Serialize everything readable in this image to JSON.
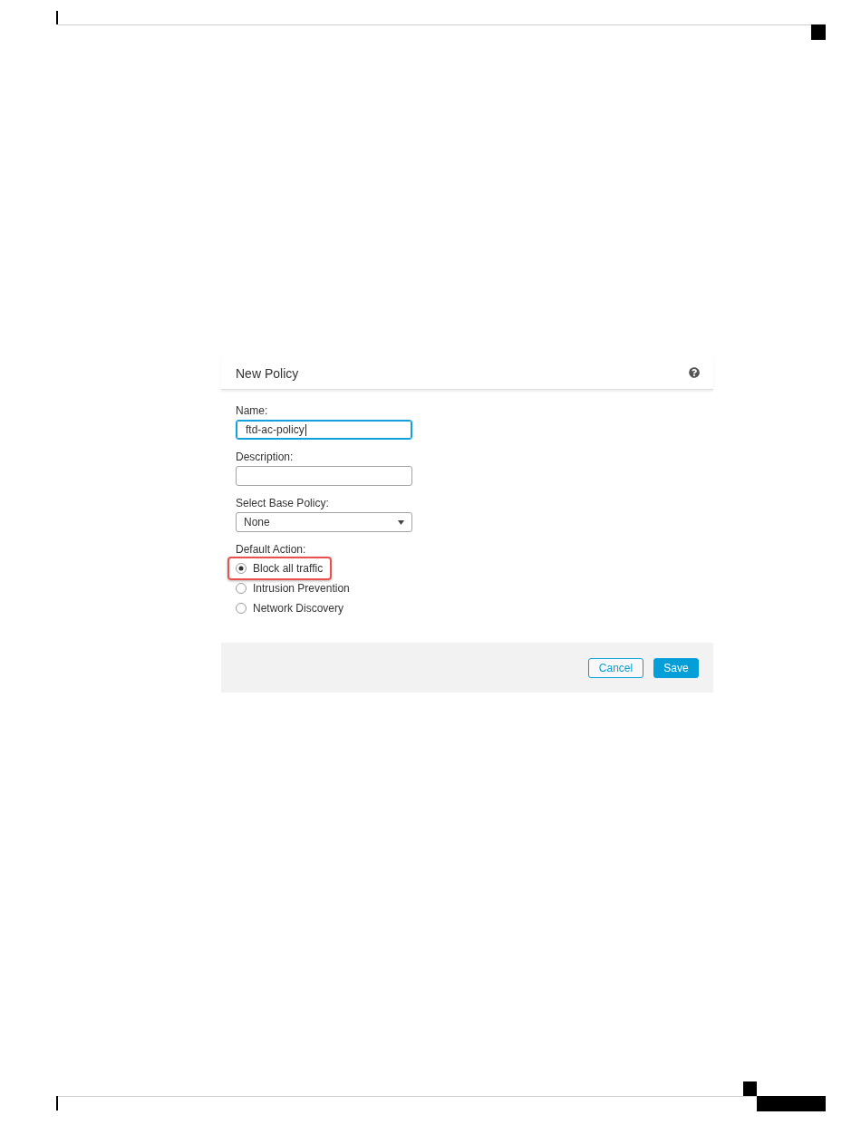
{
  "dialog": {
    "title": "New Policy",
    "fields": [
      {
        "kind": "text",
        "label": "Name:",
        "value": "ftd-ac-policy",
        "focused": true
      },
      {
        "kind": "text",
        "label": "Description:",
        "focused": false
      },
      {
        "kind": "select",
        "label": "Select Base Policy:",
        "value": "None"
      }
    ],
    "default_action": {
      "label": "Default Action:",
      "options": [
        {
          "label": "Block all traffic",
          "selected": true,
          "highlighted": true
        },
        {
          "label": "Intrusion Prevention",
          "selected": false,
          "highlighted": false
        },
        {
          "label": "Network Discovery",
          "selected": false,
          "highlighted": false
        }
      ]
    },
    "buttons": [
      {
        "label": "Cancel",
        "kind": "secondary"
      },
      {
        "label": "Save",
        "kind": "primary"
      }
    ]
  }
}
